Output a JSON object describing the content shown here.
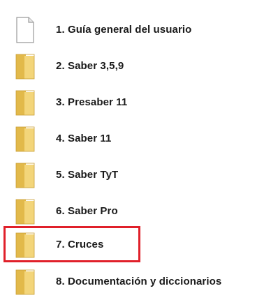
{
  "items": [
    {
      "label": "1. Guía general del usuario",
      "type": "document"
    },
    {
      "label": "2. Saber 3,5,9",
      "type": "folder"
    },
    {
      "label": "3. Presaber 11",
      "type": "folder"
    },
    {
      "label": "4. Saber 11",
      "type": "folder"
    },
    {
      "label": "5. Saber TyT",
      "type": "folder"
    },
    {
      "label": "6. Saber Pro",
      "type": "folder"
    },
    {
      "label": "7. Cruces",
      "type": "folder",
      "highlighted": true
    },
    {
      "label": "8. Documentación y diccionarios",
      "type": "folder"
    }
  ],
  "colors": {
    "folder_fill": "#f3d57a",
    "folder_shade": "#e2b94a",
    "highlight_border": "#e0202a",
    "document_fill": "#ffffff"
  }
}
